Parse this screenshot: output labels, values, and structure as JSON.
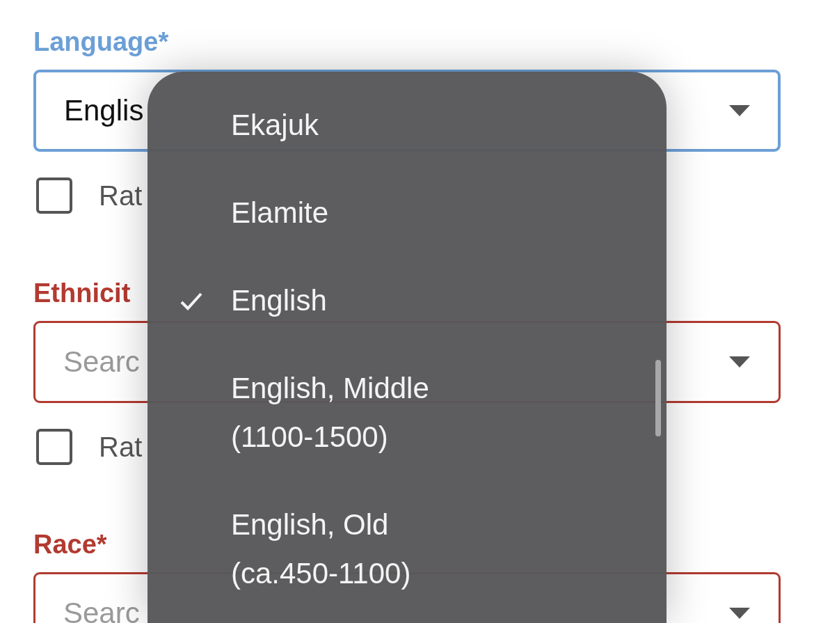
{
  "form": {
    "fields": [
      {
        "label": "Language*",
        "invalid": false,
        "focused": true,
        "value": "Englis",
        "checkbox": {
          "label": "Rat",
          "checked": false
        }
      },
      {
        "label": "Ethnicit",
        "invalid": true,
        "focused": false,
        "placeholder": "Searc",
        "checkbox": {
          "label": "Rat",
          "checked": false
        }
      },
      {
        "label": "Race*",
        "invalid": true,
        "focused": false,
        "placeholder": "Searc"
      }
    ]
  },
  "dropdown": {
    "options": [
      {
        "label": "Ekajuk",
        "selected": false
      },
      {
        "label": "Elamite",
        "selected": false
      },
      {
        "label": "English",
        "selected": true
      },
      {
        "label": "English, Middle (1100-1500)",
        "selected": false
      },
      {
        "label": "English, Old (ca.450-1100)",
        "selected": false
      }
    ]
  }
}
